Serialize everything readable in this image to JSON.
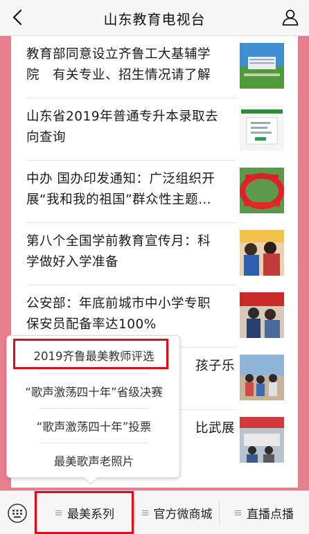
{
  "header": {
    "title": "山东教育电视台"
  },
  "articles": [
    {
      "title": "教育部同意设立齐鲁工大基辅学院　有关专业、招生情况请了解",
      "thumb": "campus-building-photo"
    },
    {
      "title": "山东省2019年普通专升本录取去向查询",
      "thumb": "website-screenshot"
    },
    {
      "title": "中办 国办印发通知：广泛组织开展“我和我的祖国”群众性主题…",
      "thumb": "red-flag-formation-photo"
    },
    {
      "title": "第八个全国学前教育宣传月：科学做好入学准备",
      "thumb": "kindergarten-children-photo"
    },
    {
      "title": "公安部：年底前城市中小学专职保安员配备率达100%",
      "thumb": "school-security-photo"
    },
    {
      "title_tail": "孩子乐",
      "thumb": "students-photo"
    },
    {
      "title_tail": "比武展",
      "thumb": "classroom-photo"
    }
  ],
  "popup_menu": {
    "items": [
      "2019齐鲁最美教师评选",
      "“歌声激荡四十年”省级决赛",
      "“歌声激荡四十年”投票",
      "最美歌声老照片"
    ]
  },
  "bottom_menu": {
    "items": [
      "最美系列",
      "官方微商城",
      "直播点播"
    ]
  },
  "colors": {
    "background": "#e87f8f",
    "highlight": "#e5091a"
  }
}
